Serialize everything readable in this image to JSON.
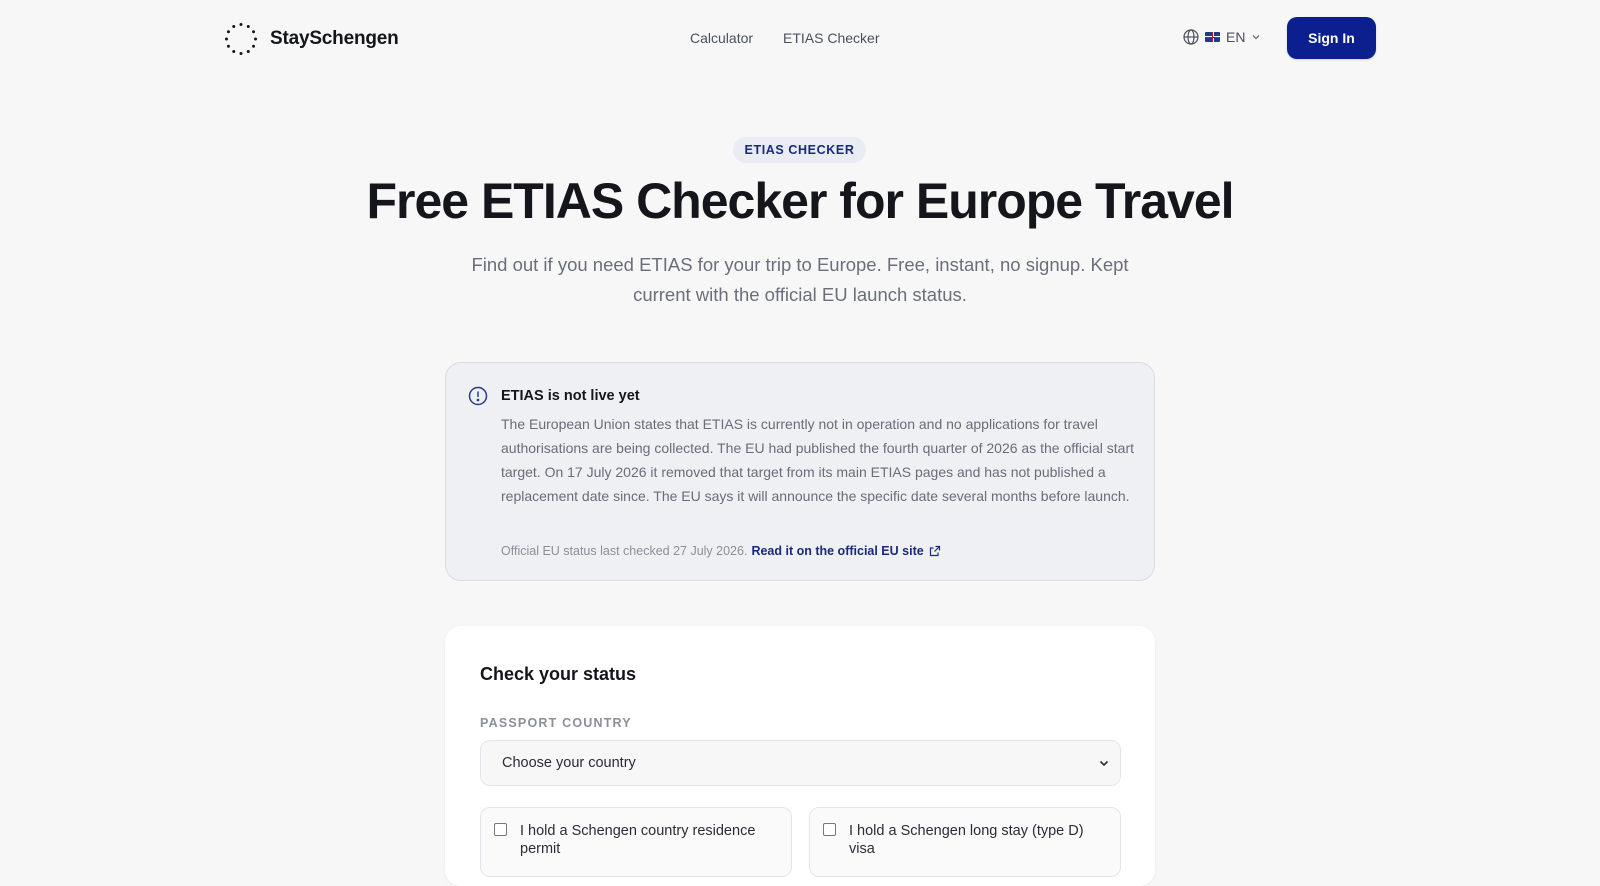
{
  "header": {
    "brand": "StaySchengen",
    "nav": [
      {
        "label": "Calculator"
      },
      {
        "label": "ETIAS Checker"
      }
    ],
    "language": "EN",
    "sign_in": "Sign In"
  },
  "hero": {
    "eyebrow": "ETIAS CHECKER",
    "title": "Free ETIAS Checker for Europe Travel",
    "subtitle": "Find out if you need ETIAS for your trip to Europe. Free, instant, no signup. Kept current with the official EU launch status."
  },
  "notice": {
    "title": "ETIAS is not live yet",
    "body": "The European Union states that ETIAS is currently not in operation and no applications for travel authorisations are being collected. The EU had published the fourth quarter of 2026 as the official start target. On 17 July 2026 it removed that target from its main ETIAS pages and has not published a replacement date since. The EU says it will announce the specific date several months before launch.",
    "last_checked": "Official EU status last checked 27 July 2026.",
    "link_label": "Read it on the official EU site"
  },
  "form": {
    "title": "Check your status",
    "passport_label": "PASSPORT COUNTRY",
    "passport_value": "Choose your country",
    "checkboxes": [
      {
        "label": "I hold a Schengen country residence permit"
      },
      {
        "label": "I hold a Schengen long stay (type D) visa"
      }
    ]
  },
  "colors": {
    "primary": "#0b1f8f",
    "background": "#f7f7f7",
    "notice_bg": "#eff0f3"
  }
}
